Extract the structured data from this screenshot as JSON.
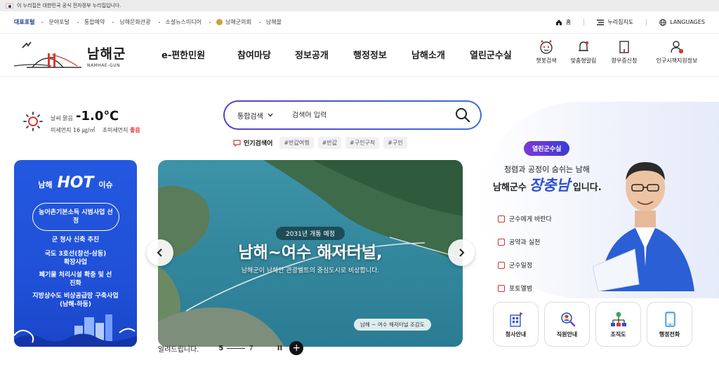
{
  "gov_banner": {
    "text": "이 누리집은 대한민국 공식 전자정부 누리집입니다."
  },
  "utility": {
    "rep_label": "대표포털",
    "links": [
      "분야포털",
      "통합예약",
      "남해문화관광",
      "소셜뉴스미디어",
      "남해군의회",
      "남해몰"
    ],
    "home": "홈",
    "sitemap": "누리집지도",
    "languages": "LANGUAGES"
  },
  "header": {
    "logo_ko": "남해군",
    "logo_en": "NAMHAE-GUN",
    "menus": [
      "e-편한민원",
      "참여마당",
      "정보공개",
      "행정정보",
      "남해소개",
      "열린군수실"
    ],
    "quick": [
      "챗봇검색",
      "맞춤형알림",
      "향우증신청",
      "인구시책지원정보"
    ]
  },
  "weather": {
    "desc": "날씨 맑음",
    "temp": "-1.0℃",
    "fine_dust_label": "미세먼지",
    "fine_dust_value": "16 ㎍/㎥",
    "ultra_dust_label": "초미세먼지",
    "ultra_dust_value": "좋음"
  },
  "search": {
    "category": "통합검색",
    "placeholder": "검색어 입력",
    "popular_title": "인기검색어",
    "tags": [
      "#반값여행",
      "#반값",
      "#구인구직",
      "#구인"
    ]
  },
  "hot": {
    "title_pre": "남해",
    "title_big": "HOT",
    "title_post": "이슈",
    "pill": "농어촌기본소득 시범사업 선정",
    "items": [
      "군 청사 신축 추진",
      "국도 3호선(창선-삼동) 확장사업",
      "폐기물 처리시설 확충 및 선진화",
      "지방상수도 비상공급망 구축사업(남해-하동)"
    ]
  },
  "slide": {
    "kicker": "2031년 개통 예정",
    "headline": "남해~여수 해저터널,",
    "sub": "남해군이 남해안 관광벨트의 중심도시로 비상합니다.",
    "caption": "남해 ~ 여수 해저터널 조감도"
  },
  "notice": {
    "label": "알려드립니다.",
    "current": "5",
    "total": "7",
    "pause": "II",
    "more": "+"
  },
  "mayor": {
    "badge": "열린군수실",
    "line1": "청렴과 공정이 숨쉬는 남해",
    "line2_pre": "남해군수",
    "name": "장충남",
    "line2_post": "입니다.",
    "links": [
      "군수에게 바란다",
      "공약과 실천",
      "군수일정",
      "포토앨범"
    ]
  },
  "services": [
    "청사안내",
    "직원안내",
    "조직도",
    "행정전화"
  ]
}
